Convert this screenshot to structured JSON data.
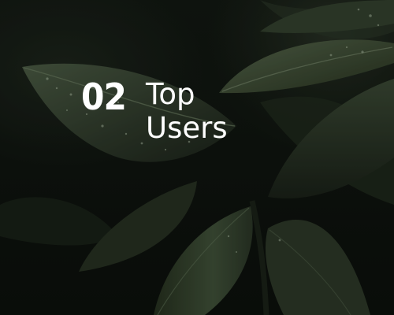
{
  "header": {
    "number": "02",
    "title_line1": "Top",
    "title_line2": "Users"
  },
  "colors": {
    "text": "#ffffff",
    "leaf": "#3c4a36",
    "background": "#0d120d"
  }
}
